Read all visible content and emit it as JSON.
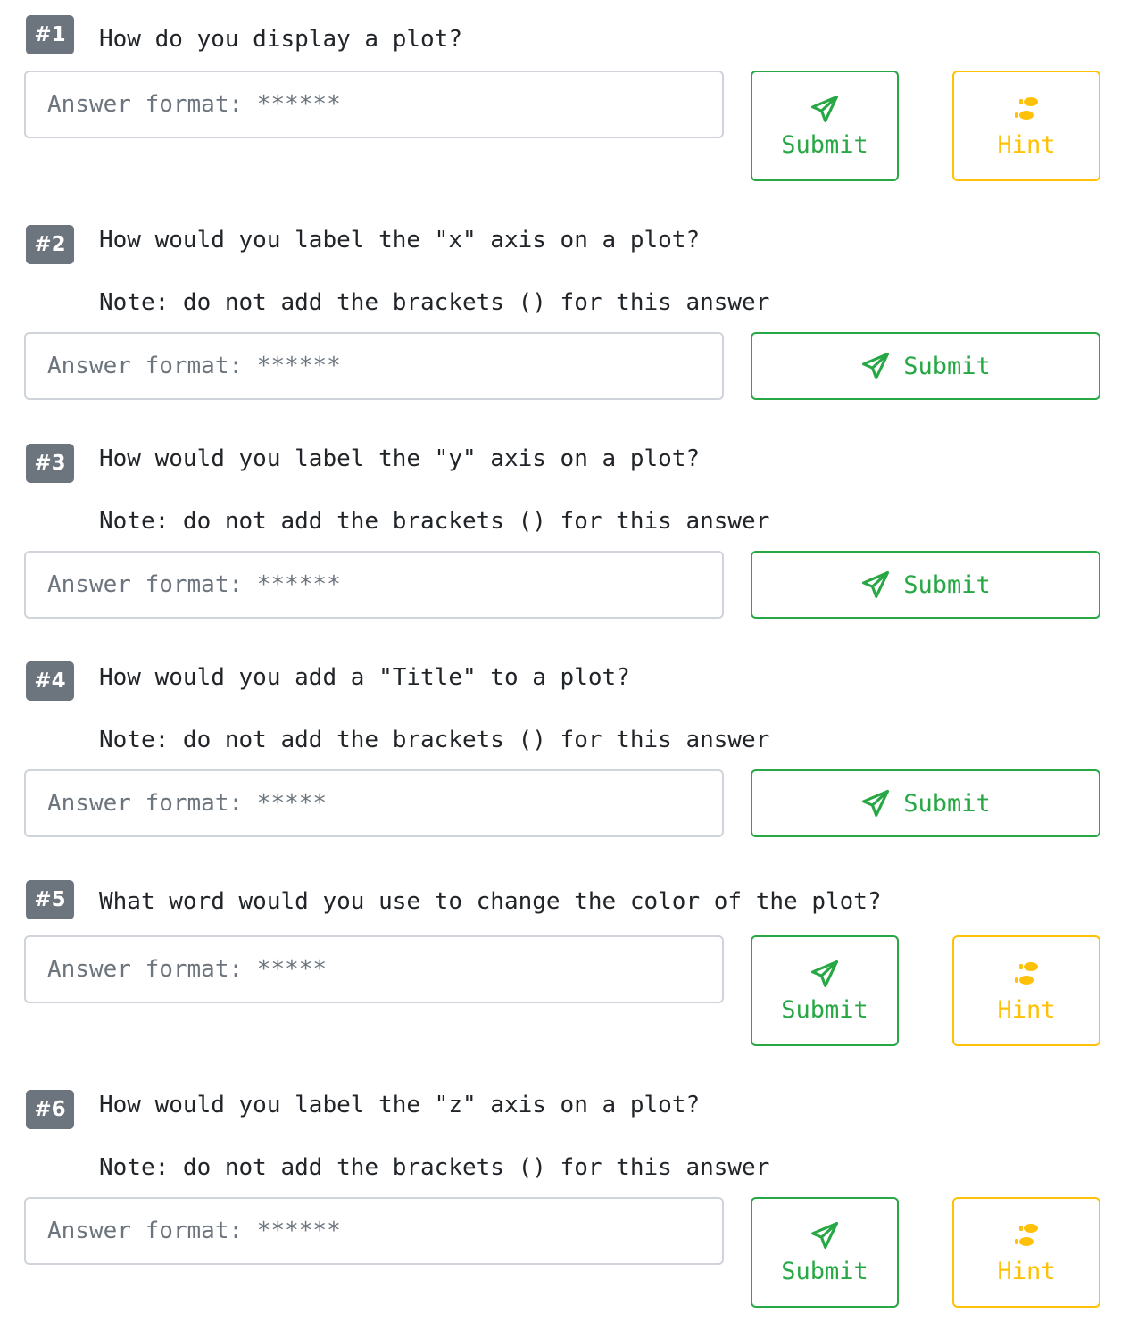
{
  "questions": [
    {
      "number": "#1",
      "text": "How do you display a plot?",
      "note": "",
      "placeholder": "Answer format: ******",
      "submit_label": "Submit",
      "hint_label": "Hint"
    },
    {
      "number": "#2",
      "text": "How would you label the \"x\" axis on a plot?",
      "note": "Note: do not add the brackets () for this answer",
      "placeholder": "Answer format: ******",
      "submit_label": "Submit"
    },
    {
      "number": "#3",
      "text": "How would you label the \"y\" axis on a plot?",
      "note": "Note: do not add the brackets () for this answer",
      "placeholder": "Answer format: ******",
      "submit_label": "Submit"
    },
    {
      "number": "#4",
      "text": "How would you add a \"Title\" to a plot?",
      "note": "Note: do not add the brackets () for this answer",
      "placeholder": "Answer format: *****",
      "submit_label": "Submit"
    },
    {
      "number": "#5",
      "text": "What word would you use to change the color of the plot?",
      "note": "",
      "placeholder": "Answer format: *****",
      "submit_label": "Submit",
      "hint_label": "Hint"
    },
    {
      "number": "#6",
      "text": "How would you label the \"z\" axis on a plot?",
      "note": "Note: do not add the brackets () for this answer",
      "placeholder": "Answer format: ******",
      "submit_label": "Submit",
      "hint_label": "Hint"
    }
  ],
  "icons": {
    "submit": "paper-plane-icon",
    "hint": "shoe-prints-icon"
  },
  "colors": {
    "submit": "#28a745",
    "hint": "#ffc107",
    "badge": "#6c757d"
  }
}
